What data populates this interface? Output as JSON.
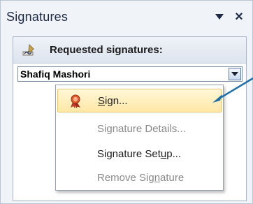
{
  "pane": {
    "title": "Signatures",
    "dropdown_icon": "triangle-down-icon",
    "close_label": "×"
  },
  "requested": {
    "label": "Requested signatures:",
    "icon": "pen-signature-icon"
  },
  "combo": {
    "value": "Shafiq Mashori"
  },
  "menu": {
    "sign": {
      "pre": "",
      "u": "S",
      "post": "ign...",
      "icon": "signature-ribbon-icon",
      "enabled": true,
      "highlighted": true
    },
    "details": {
      "pre": "Si",
      "u": "g",
      "post": "nature Details...",
      "enabled": false
    },
    "setup": {
      "pre": "Signature Set",
      "u": "u",
      "post": "p...",
      "enabled": true
    },
    "remove": {
      "pre": "Remove Sig",
      "u": "n",
      "post": "ature",
      "enabled": false
    }
  },
  "colors": {
    "highlight": "#ffe8a6",
    "disabled_text": "#8a8a8a",
    "callout": "#1f6fa8"
  }
}
